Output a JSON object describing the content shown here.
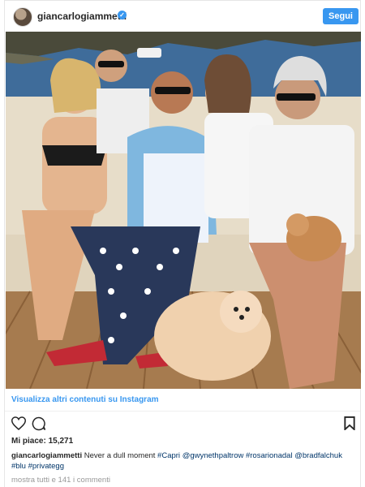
{
  "post": {
    "username": "giancarlogiammetti",
    "verified_badge": "✓",
    "follow_label": "Segui",
    "more_link": "Visualizza altri contenuti su Instagram",
    "likes_text": "Mi piace: 15,271",
    "caption_user": "giancarlogiammetti",
    "caption_text": "Never a dull moment",
    "caption_tags": [
      "#Capri",
      "@gwynethpaltrow",
      "#rosarionadal",
      "@bradfalchuk",
      "#blu",
      "#privategg"
    ],
    "comments_text": "mostra tutti e 141 i commenti"
  },
  "icons": {
    "like": "heart-icon",
    "comment": "comment-bubble-icon",
    "save": "bookmark-icon"
  },
  "colors": {
    "accent": "#3897f0",
    "text": "#262626",
    "muted": "#999999"
  }
}
